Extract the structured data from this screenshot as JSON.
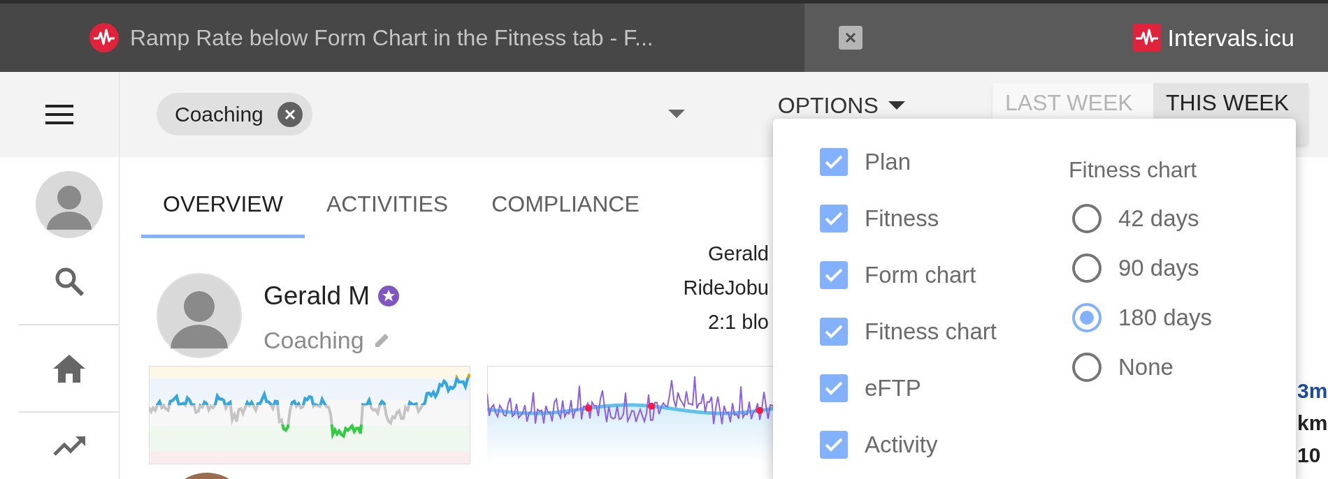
{
  "browser_tabs": [
    {
      "title": "Ramp Rate below Form Chart in the Fitness tab - F...",
      "selected": false
    },
    {
      "title": "Intervals.icu",
      "selected": true
    }
  ],
  "toolbar": {
    "filter_chip": "Coaching",
    "options": "OPTIONS",
    "range_buttons": [
      {
        "label": "LAST WEEK",
        "selected": false
      },
      {
        "label": "THIS WEEK",
        "selected": true
      }
    ]
  },
  "tabs": [
    {
      "label": "OVERVIEW",
      "selected": true
    },
    {
      "label": "ACTIVITIES",
      "selected": false
    },
    {
      "label": "COMPLIANCE",
      "selected": false
    }
  ],
  "athlete": {
    "name": "Gerald M",
    "group": "Coaching"
  },
  "summary_lines": [
    "Gerald",
    "RideJobu",
    "2:1 blo"
  ],
  "edge_texts": [
    {
      "text": "3m",
      "kind": "link"
    },
    {
      "text": "km",
      "kind": "text"
    },
    {
      "text": "10",
      "kind": "text"
    }
  ],
  "options_menu": {
    "checkboxes": [
      {
        "label": "Plan",
        "checked": true
      },
      {
        "label": "Fitness",
        "checked": true
      },
      {
        "label": "Form chart",
        "checked": true
      },
      {
        "label": "Fitness chart",
        "checked": true
      },
      {
        "label": "eFTP",
        "checked": true
      },
      {
        "label": "Activity",
        "checked": true
      }
    ],
    "fitness_chart": {
      "title": "Fitness chart",
      "options": [
        {
          "label": "42 days",
          "selected": false
        },
        {
          "label": "90 days",
          "selected": false
        },
        {
          "label": "180 days",
          "selected": true
        },
        {
          "label": "None",
          "selected": false
        }
      ]
    }
  }
}
